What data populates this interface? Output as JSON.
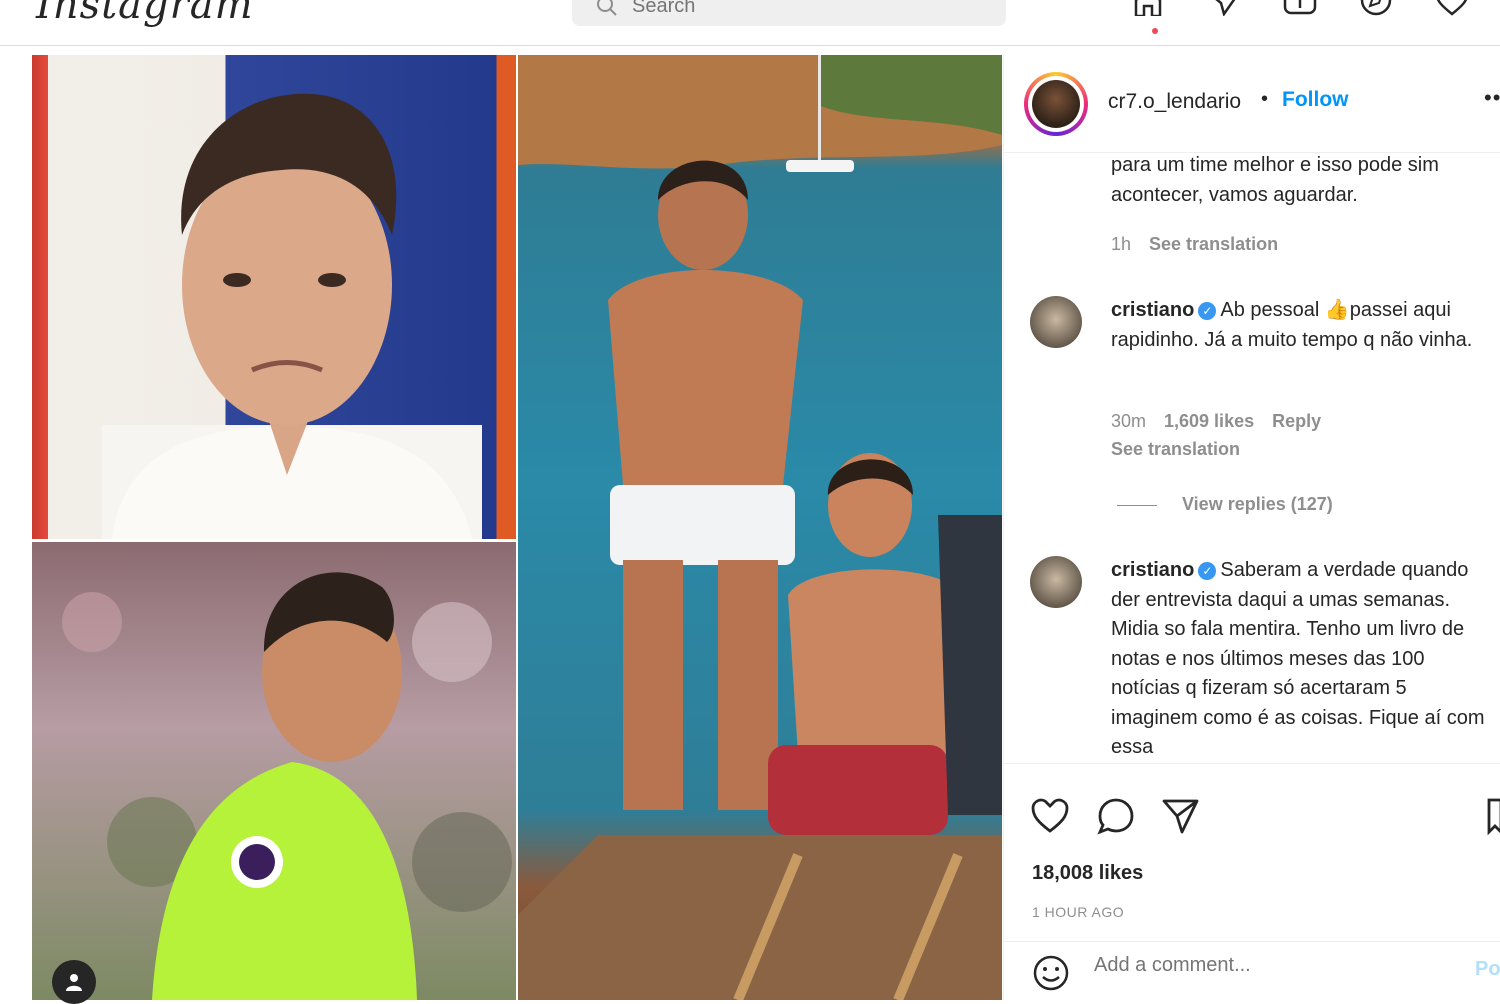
{
  "nav": {
    "logo": "Instagram",
    "search_placeholder": "Search",
    "icons": [
      "home-icon",
      "direct-message-icon",
      "new-post-icon",
      "explore-icon",
      "heart-icon"
    ]
  },
  "post": {
    "username": "cr7.o_lendario",
    "separator": "•",
    "follow_label": "Follow",
    "more_label": "••",
    "likes": "18,008 likes",
    "time_ago": "1 HOUR AGO"
  },
  "comments": [
    {
      "text": "para um time melhor e isso pode sim acontecer, vamos aguardar.",
      "time": "1h",
      "see_translation": "See translation"
    },
    {
      "user": "cristiano",
      "verified": "✓",
      "text": "Ab pessoal 👍passei aqui rapidinho. Já a muito tempo q não vinha.",
      "time": "30m",
      "likes": "1,609 likes",
      "reply": "Reply",
      "see_translation": "See translation",
      "view_replies": "View replies (127)"
    },
    {
      "user": "cristiano",
      "verified": "✓",
      "text": "Saberam a verdade quando der entrevista daqui a umas semanas. Midia so fala mentira. Tenho um livro de notas e nos últimos meses das 100 notícias q fizeram só acertaram 5 imaginem como é as coisas. Fique aí com essa"
    }
  ],
  "add_comment": {
    "placeholder": "Add a comment...",
    "post_label": "Po"
  },
  "colors": {
    "link_blue": "#0095f6",
    "verified_blue": "#3897f0",
    "muted": "#8e8e8e",
    "notification_red": "#ed4956"
  }
}
